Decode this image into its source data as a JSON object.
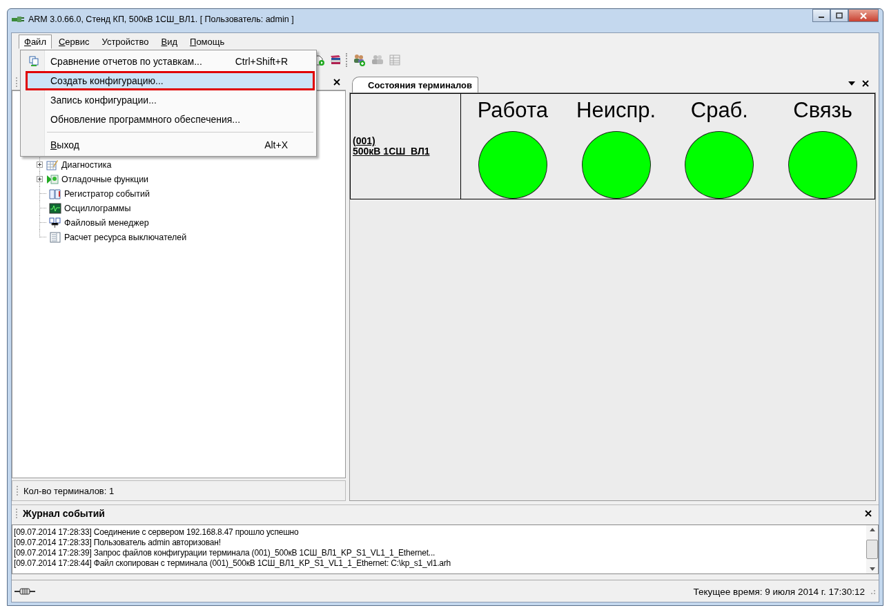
{
  "window": {
    "title": "ARM 3.0.66.0, Стенд КП, 500кВ 1СШ_ВЛ1. [ Пользователь: admin ]"
  },
  "menu_bar": [
    {
      "label": "Файл",
      "mnemonic": true,
      "selected": true
    },
    {
      "label": "Сервис",
      "mnemonic": true,
      "selected": false
    },
    {
      "label": "Устройство",
      "mnemonic": false,
      "selected": false
    },
    {
      "label": "Вид",
      "mnemonic": true,
      "selected": false
    },
    {
      "label": "Помощь",
      "mnemonic": true,
      "selected": false
    }
  ],
  "file_menu": [
    {
      "kind": "item",
      "label": "Сравнение отчетов по уставкам...",
      "shortcut": "Ctrl+Shift+R",
      "icon": true,
      "selected": false,
      "marked": false,
      "mnemonic": false
    },
    {
      "kind": "item",
      "label": "Создать конфигурацию...",
      "icon": false,
      "selected": true,
      "marked": true,
      "mnemonic": false
    },
    {
      "kind": "item",
      "label": "Запись конфигурации...",
      "icon": false,
      "selected": false,
      "marked": false,
      "mnemonic": false
    },
    {
      "kind": "item",
      "label": "Обновление программного обеспечения...",
      "icon": false,
      "selected": false,
      "marked": false,
      "mnemonic": false
    },
    {
      "kind": "separator"
    },
    {
      "kind": "item",
      "label": "Выход",
      "shortcut": "Alt+X",
      "icon": false,
      "selected": false,
      "marked": false,
      "mnemonic": true
    }
  ],
  "tree": [
    {
      "label": "Диагностика",
      "expandable": true
    },
    {
      "label": "Отладочные функции",
      "expandable": true
    },
    {
      "label": "Регистратор событий",
      "expandable": false
    },
    {
      "label": "Осциллограммы",
      "expandable": false
    },
    {
      "label": "Файловый менеджер",
      "expandable": false
    },
    {
      "label": "Расчет ресурса выключателей",
      "expandable": false
    }
  ],
  "left_status": "Кол-во терминалов: 1",
  "right_panel": {
    "tab": "Состояния терминалов",
    "terminal": {
      "number": "(001)",
      "name": "500кВ 1СШ_ВЛ1"
    },
    "indicators": [
      {
        "label": "Работа",
        "color": "#00ff00"
      },
      {
        "label": "Неиспр.",
        "color": "#00ff00"
      },
      {
        "label": "Сраб.",
        "color": "#00ff00"
      },
      {
        "label": "Связь",
        "color": "#00ff00"
      }
    ]
  },
  "event_log": {
    "title": "Журнал событий",
    "entries": [
      "[09.07.2014 17:28:33] Соединение с сервером 192.168.8.47 прошло успешно",
      "[09.07.2014 17:28:33] Пользователь admin авторизован!",
      "[09.07.2014 17:28:39] Запрос файлов конфигурации терминала (001)_500кВ 1СШ_ВЛ1_KP_S1_VL1_1_Ethernet...",
      "[09.07.2014 17:28:44] Файл скопирован с терминала (001)_500кВ 1СШ_ВЛ1_KP_S1_VL1_1_Ethernet: C:\\kp_s1_vl1.arh"
    ]
  },
  "status_bar": {
    "time": "Текущее время: 9 июля 2014 г. 17:30:12"
  }
}
